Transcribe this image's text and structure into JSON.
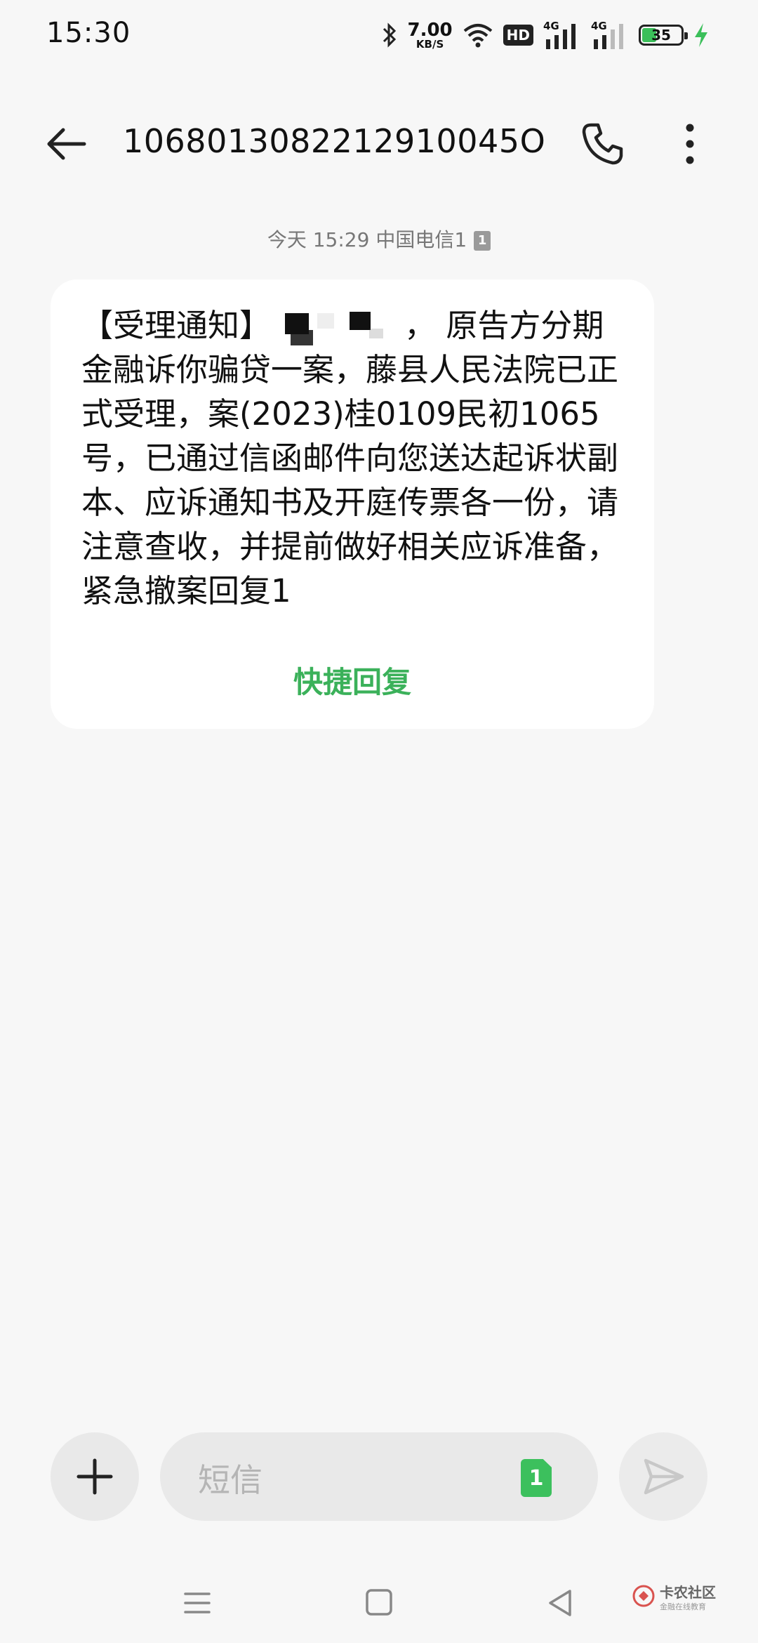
{
  "status_bar": {
    "time": "15:30",
    "net_speed_value": "7.00",
    "net_speed_unit": "KB/S",
    "hd_label": "HD",
    "signal1_label": "4G",
    "signal2_label": "4G",
    "battery_level": "35",
    "icons": [
      "bluetooth-icon",
      "wifi-icon",
      "hd-icon",
      "signal-icon",
      "signal-icon",
      "battery-icon",
      "charging-icon"
    ]
  },
  "header": {
    "title": "1068013082212910045O",
    "icons": [
      "back-arrow-icon",
      "phone-icon",
      "more-vertical-icon"
    ]
  },
  "message": {
    "meta": "今天 15:29  中国电信1",
    "sim_badge": "1",
    "text_before_redaction": "【受理通知】",
    "text_after_redaction": "，  原告方分期金融诉你骗贷一案，藤县人民法院已正式受理，案(2023)桂0109民初1065号，已通过信函邮件向您送达起诉状副本、应诉通知书及开庭传票各一份，请注意查收，并提前做好相关应诉准备，紧急撤案回复1",
    "quick_reply": "快捷回复"
  },
  "composer": {
    "placeholder": "短信",
    "sim_select_label": "1",
    "icons": [
      "plus-icon",
      "send-icon"
    ]
  },
  "nav_bar": {
    "icons": [
      "menu-icon",
      "home-square-icon",
      "back-triangle-icon"
    ]
  },
  "watermark": {
    "title": "卡农社区",
    "subtitle": "金融在线教育"
  },
  "colors": {
    "accent_green": "#3bb15a",
    "background": "#f7f7f7",
    "bubble": "#ffffff"
  }
}
